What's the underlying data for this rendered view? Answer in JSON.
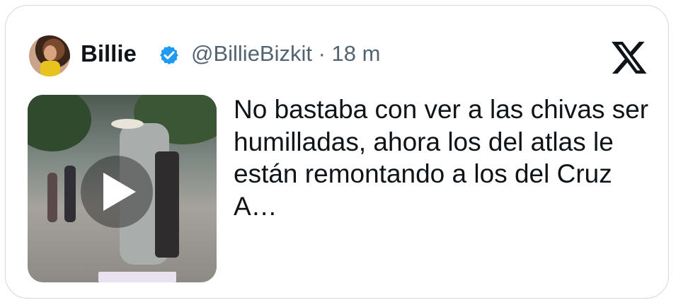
{
  "author": {
    "display_name": "Billie",
    "handle_time": "@BillieBizkit · 18 m",
    "verified": true
  },
  "tweet": {
    "text": "No bastaba con ver a las chivas ser humilladas, ahora los del atlas le están remontando a los del Cruz A…"
  },
  "media": {
    "type": "video",
    "play_icon": "play-icon"
  },
  "brand": {
    "logo": "x-logo-icon"
  },
  "colors": {
    "text": "#0f1419",
    "secondary": "#536471",
    "verified_blue": "#1d9bf0",
    "border": "#cfd9de"
  }
}
